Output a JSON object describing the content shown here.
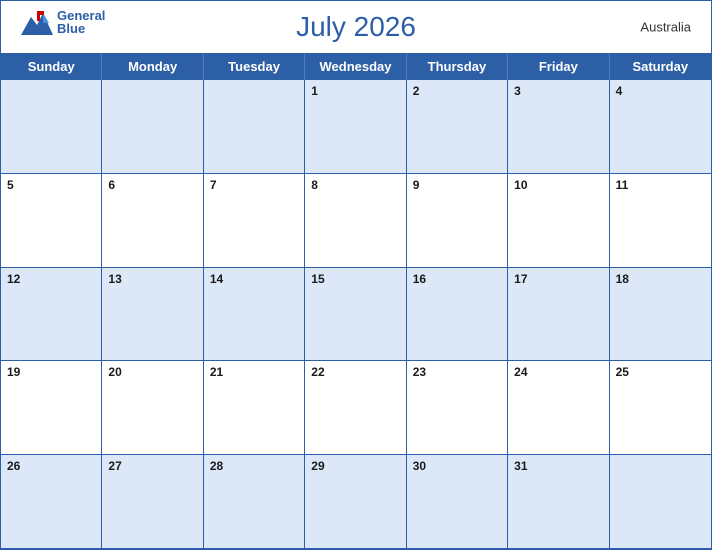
{
  "header": {
    "title": "July 2026",
    "country": "Australia",
    "logo": {
      "line1": "General",
      "line2": "Blue"
    }
  },
  "days_of_week": [
    "Sunday",
    "Monday",
    "Tuesday",
    "Wednesday",
    "Thursday",
    "Friday",
    "Saturday"
  ],
  "weeks": [
    [
      {
        "date": "",
        "row": 1
      },
      {
        "date": "",
        "row": 1
      },
      {
        "date": "",
        "row": 1
      },
      {
        "date": "1",
        "row": 1
      },
      {
        "date": "2",
        "row": 1
      },
      {
        "date": "3",
        "row": 1
      },
      {
        "date": "4",
        "row": 1
      }
    ],
    [
      {
        "date": "5",
        "row": 2
      },
      {
        "date": "6",
        "row": 2
      },
      {
        "date": "7",
        "row": 2
      },
      {
        "date": "8",
        "row": 2
      },
      {
        "date": "9",
        "row": 2
      },
      {
        "date": "10",
        "row": 2
      },
      {
        "date": "11",
        "row": 2
      }
    ],
    [
      {
        "date": "12",
        "row": 3
      },
      {
        "date": "13",
        "row": 3
      },
      {
        "date": "14",
        "row": 3
      },
      {
        "date": "15",
        "row": 3
      },
      {
        "date": "16",
        "row": 3
      },
      {
        "date": "17",
        "row": 3
      },
      {
        "date": "18",
        "row": 3
      }
    ],
    [
      {
        "date": "19",
        "row": 4
      },
      {
        "date": "20",
        "row": 4
      },
      {
        "date": "21",
        "row": 4
      },
      {
        "date": "22",
        "row": 4
      },
      {
        "date": "23",
        "row": 4
      },
      {
        "date": "24",
        "row": 4
      },
      {
        "date": "25",
        "row": 4
      }
    ],
    [
      {
        "date": "26",
        "row": 5
      },
      {
        "date": "27",
        "row": 5
      },
      {
        "date": "28",
        "row": 5
      },
      {
        "date": "29",
        "row": 5
      },
      {
        "date": "30",
        "row": 5
      },
      {
        "date": "31",
        "row": 5
      },
      {
        "date": "",
        "row": 5
      }
    ]
  ],
  "colors": {
    "primary": "#2d5fa6",
    "row_blue": "#dce8f8",
    "row_white": "#ffffff"
  }
}
